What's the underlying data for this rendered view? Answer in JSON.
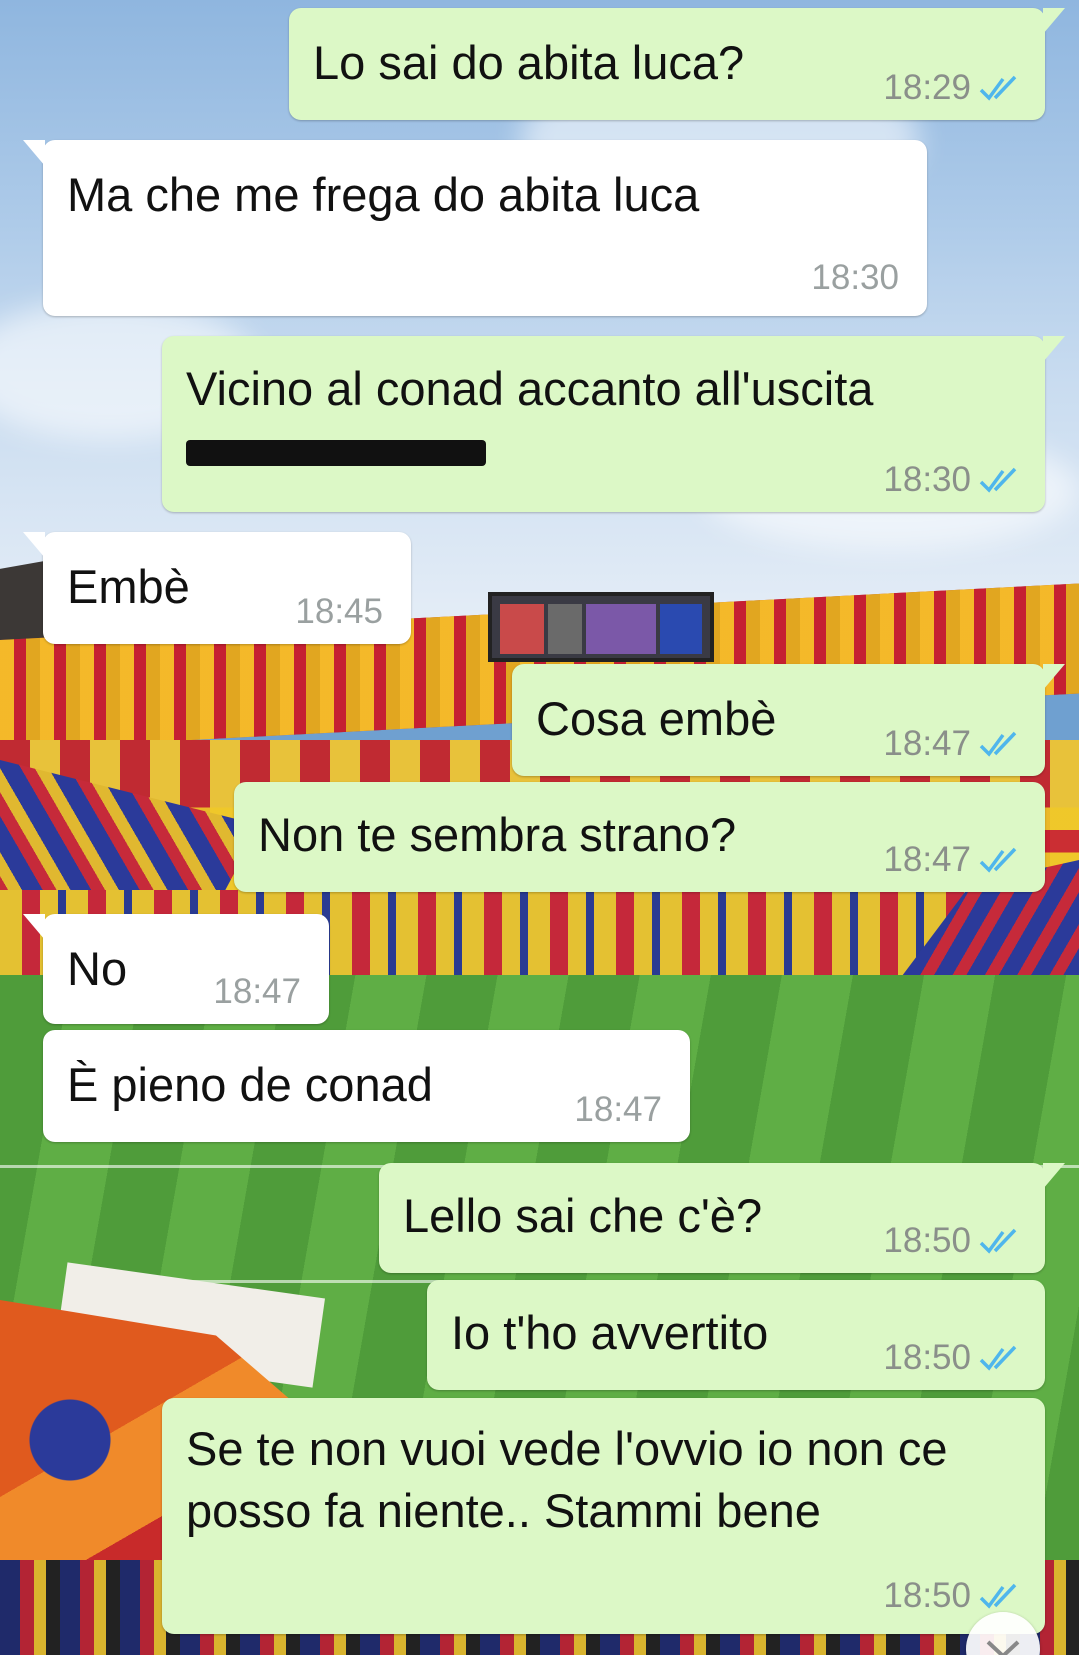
{
  "conversation": {
    "messages": [
      {
        "direction": "out",
        "text": "Lo sai do abita luca?",
        "time": "18:29",
        "status": "read"
      },
      {
        "direction": "in",
        "text": "Ma che me frega do abita luca",
        "time": "18:30"
      },
      {
        "direction": "out",
        "text": "Vicino al conad accanto all'uscita",
        "time": "18:30",
        "status": "read",
        "redacted": true
      },
      {
        "direction": "in",
        "text": "Embè",
        "time": "18:45"
      },
      {
        "direction": "out",
        "text": "Cosa embè",
        "time": "18:47",
        "status": "read"
      },
      {
        "direction": "out",
        "text": "Non te sembra strano?",
        "time": "18:47",
        "status": "read"
      },
      {
        "direction": "in",
        "text": "No",
        "time": "18:47"
      },
      {
        "direction": "in",
        "text": "È pieno de conad",
        "time": "18:47"
      },
      {
        "direction": "out",
        "text": "Lello sai che c'è?",
        "time": "18:50",
        "status": "read"
      },
      {
        "direction": "out",
        "text": "Io t'ho avvertito",
        "time": "18:50",
        "status": "read"
      },
      {
        "direction": "out",
        "text": "Se te non vuoi vede l'ovvio io non ce posso fa niente.. Stammi bene",
        "time": "18:50",
        "status": "read"
      }
    ]
  },
  "colors": {
    "outgoing_bubble": "#dcf8c6",
    "incoming_bubble": "#ffffff",
    "read_ticks": "#4fb6ec",
    "timestamp": "#8a8f8a"
  },
  "icons": {
    "read_receipt": "double-check-icon",
    "scroll_down": "chevron-down-icon"
  }
}
